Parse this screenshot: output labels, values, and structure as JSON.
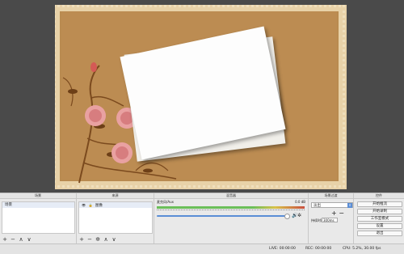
{
  "panels": {
    "scenes": {
      "title": "场景",
      "items": [
        "场景"
      ]
    },
    "sources": {
      "title": "来源",
      "items": [
        {
          "label": "图像",
          "visible": true,
          "locked": true
        }
      ]
    },
    "mixer": {
      "title": "混音器",
      "channel": "麦克风/Aux",
      "level": "0.0 dB",
      "volume_fraction": 0.89
    },
    "transitions": {
      "title": "场景过渡",
      "selected": "淡出",
      "duration_label": "持续时间",
      "duration_value": "300ms"
    },
    "controls": {
      "title": "控件",
      "buttons": [
        "开始推流",
        "开始录制",
        "工作室模式",
        "设置",
        "退出"
      ]
    }
  },
  "status": {
    "live": "LIVE: 00:00:00",
    "rec": "REC: 00:00:00",
    "cpu": "CPU: 5.2%, 30.00 fps"
  },
  "colors": {
    "canvas": "#b98b50",
    "frame": "#e8d2a8",
    "accent": "#5b8ed6"
  },
  "icons": {
    "add": "+",
    "remove": "−",
    "up": "∧",
    "down": "∨",
    "gear": "✲"
  }
}
